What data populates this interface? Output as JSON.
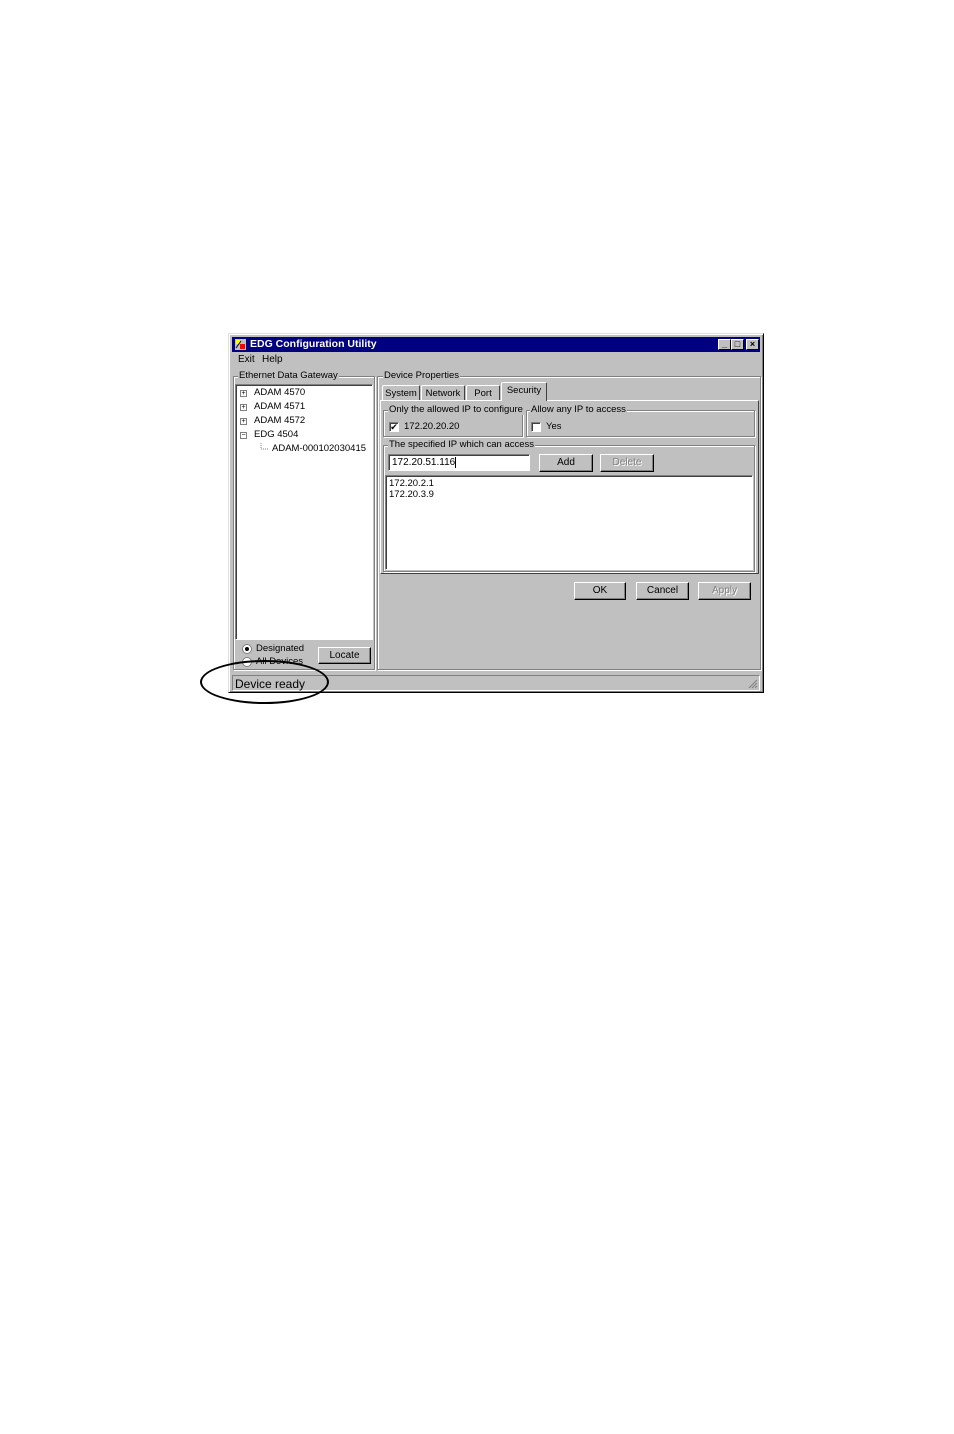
{
  "window": {
    "title": "EDG Configuration Utility",
    "controls": {
      "minimize": "_",
      "maximize": "□",
      "close": "×"
    }
  },
  "menu": [
    {
      "label": "Exit"
    },
    {
      "label": "Help"
    }
  ],
  "left_panel": {
    "group_label": "Ethernet Data Gateway",
    "tree": [
      {
        "label": "ADAM 4570",
        "expander": "+"
      },
      {
        "label": "ADAM 4571",
        "expander": "+"
      },
      {
        "label": "ADAM 4572",
        "expander": "+"
      },
      {
        "label": "EDG  4504",
        "expander": "−"
      },
      {
        "label": "ADAM-00010203041​5"
      }
    ],
    "radio_designated": "Designated",
    "radio_all": "All Devices",
    "locate_button": "Locate"
  },
  "right_panel": {
    "group_label": "Device Properties",
    "tabs": [
      {
        "label": "System"
      },
      {
        "label": "Network"
      },
      {
        "label": "Port"
      },
      {
        "label": "Security"
      }
    ],
    "only_allowed": {
      "legend": "Only the allowed IP to configure",
      "checkbox_label": "172.20.20.20",
      "checked": true
    },
    "allow_any": {
      "legend": "Allow any IP to access",
      "checkbox_label": "Yes",
      "checked": false
    },
    "specified": {
      "legend": "The specified IP which can access",
      "input_value": "172.20.51.116",
      "add_button": "Add",
      "delete_button": "Delete",
      "list": [
        "172.20.2.1",
        "172.20.3.9"
      ]
    },
    "ok_button": "OK",
    "cancel_button": "Cancel",
    "apply_button": "Apply"
  },
  "status_bar": {
    "text": "Device ready"
  }
}
